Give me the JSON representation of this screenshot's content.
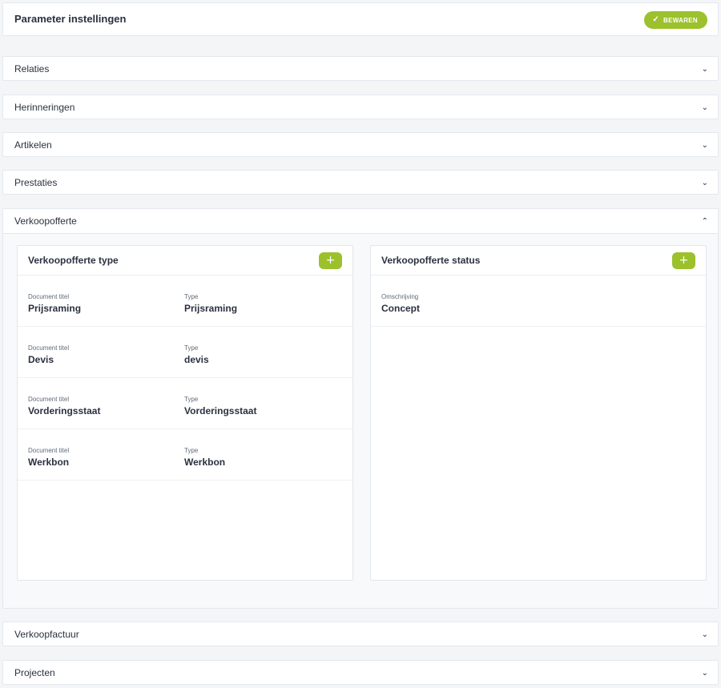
{
  "header": {
    "title": "Parameter instellingen",
    "save_label": "BEWAREN"
  },
  "colors": {
    "accent": "#9cc12c",
    "background": "#f3f5f7",
    "text": "#2a3140"
  },
  "sections": {
    "relaties": "Relaties",
    "herinneringen": "Herinneringen",
    "artikelen": "Artikelen",
    "prestaties": "Prestaties",
    "verkoopofferte": "Verkoopofferte",
    "verkoopfactuur": "Verkoopfactuur",
    "projecten": "Projecten"
  },
  "offerte_type": {
    "title": "Verkoopofferte type",
    "add_label": "+",
    "col_document": "Document titel",
    "col_type": "Type",
    "rows": [
      {
        "document": "Prijsraming",
        "type": "Prijsraming"
      },
      {
        "document": "Devis",
        "type": "devis"
      },
      {
        "document": "Vorderingsstaat",
        "type": "Vorderingsstaat"
      },
      {
        "document": "Werkbon",
        "type": "Werkbon"
      }
    ]
  },
  "offerte_status": {
    "title": "Verkoopofferte status",
    "add_label": "+",
    "col_description": "Omschrijving",
    "rows": [
      {
        "description": "Concept"
      }
    ]
  }
}
